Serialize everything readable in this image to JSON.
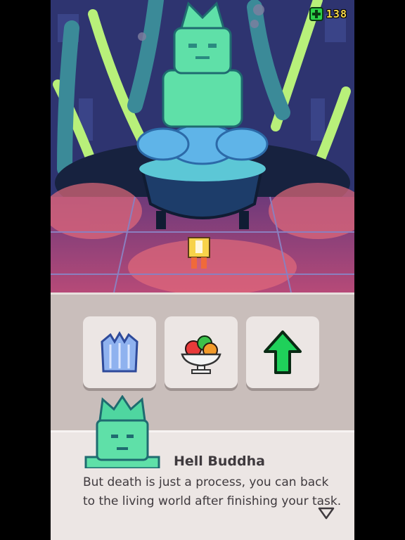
{
  "hud": {
    "currency_icon": "green-plus-icon",
    "currency_count": "138"
  },
  "items": [
    {
      "name": "crystal-armor",
      "icon": "crystal-armor-icon"
    },
    {
      "name": "fruit-bowl",
      "icon": "fruit-bowl-icon"
    },
    {
      "name": "upgrade",
      "icon": "green-up-arrow-icon"
    }
  ],
  "dialog": {
    "speaker": "Hell Buddha",
    "text": "But death is just a process, you can back to the living world after finishing your task.",
    "continue_icon": "down-triangle-icon"
  },
  "colors": {
    "statue": "#5fe0a8",
    "background": "#2a2350",
    "panel": "#c9bebb",
    "dialog": "#ece6e4"
  }
}
